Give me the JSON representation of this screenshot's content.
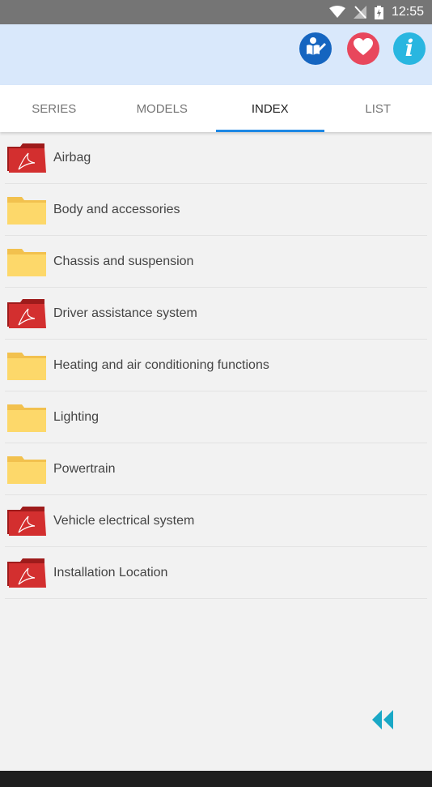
{
  "status_bar": {
    "time": "12:55"
  },
  "app_bar": {
    "actions": [
      {
        "icon": "manual-reader-icon"
      },
      {
        "icon": "heart-icon"
      },
      {
        "icon": "info-icon",
        "glyph": "i"
      }
    ]
  },
  "tabs": [
    {
      "label": "SERIES",
      "active": false
    },
    {
      "label": "MODELS",
      "active": false
    },
    {
      "label": "INDEX",
      "active": true
    },
    {
      "label": "LIST",
      "active": false
    }
  ],
  "list": [
    {
      "label": "Airbag",
      "icon": "pdf-folder-icon"
    },
    {
      "label": "Body and accessories",
      "icon": "folder-icon"
    },
    {
      "label": "Chassis and suspension",
      "icon": "folder-icon"
    },
    {
      "label": "Driver assistance system",
      "icon": "pdf-folder-icon"
    },
    {
      "label": "Heating and air conditioning functions",
      "icon": "folder-icon"
    },
    {
      "label": "Lighting",
      "icon": "folder-icon"
    },
    {
      "label": "Powertrain",
      "icon": "folder-icon"
    },
    {
      "label": "Vehicle electrical system",
      "icon": "pdf-folder-icon"
    },
    {
      "label": "Installation Location",
      "icon": "pdf-folder-icon"
    }
  ],
  "colors": {
    "app_bar": "#d9e8fb",
    "tab_indicator": "#1e88e5",
    "folder_yellow": "#fdd86a",
    "pdf_red": "#c62828",
    "rewind": "#1aa8c6"
  }
}
